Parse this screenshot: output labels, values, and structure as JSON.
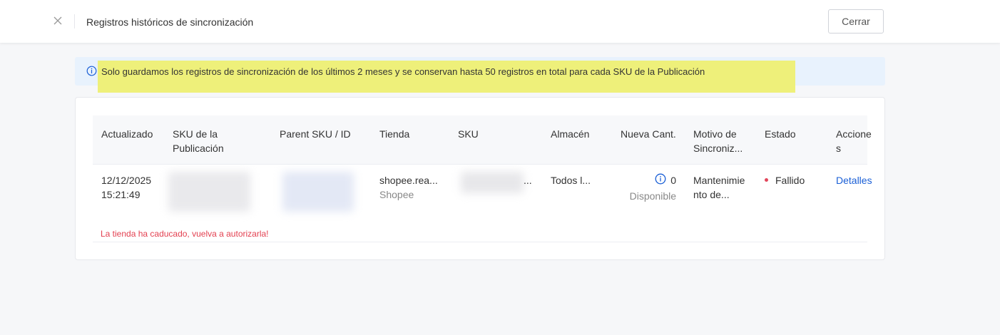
{
  "header": {
    "title": "Registros históricos de sincronización",
    "close_button": "Cerrar"
  },
  "notice": {
    "text": "Solo guardamos los registros de sincronización de los últimos 2 meses y se conservan hasta 50 registros en total para cada SKU de la Publicación",
    "highlight_color": "#eef07a"
  },
  "table": {
    "columns": [
      "Actualizado",
      "SKU de la Publicación",
      "Parent SKU / ID",
      "Tienda",
      "SKU",
      "Almacén",
      "Nueva Cant.",
      "Motivo de Sincroniz...",
      "Estado",
      "Acciones"
    ],
    "header_lines": {
      "sku_pub": [
        "SKU de la",
        "Publicación"
      ],
      "motivo": [
        "Motivo de",
        "Sincroniz..."
      ],
      "acciones": [
        "Accione",
        "s"
      ]
    },
    "rows": [
      {
        "date": "12/12/2025",
        "time": "15:21:49",
        "store_name": "shopee.rea...",
        "store_platform": "Shopee",
        "sku_suffix": "...",
        "warehouse": "Todos l...",
        "qty": "0",
        "qty_label": "Disponible",
        "reason_line1": "Mantenimie",
        "reason_line2": "nto de...",
        "status": "Fallido",
        "status_color": "#e2465b",
        "action": "Detalles"
      }
    ],
    "error_message": "La tienda ha caducado, vuelva a autorizarla!"
  },
  "icons": {
    "close": "close-icon",
    "info": "info-circle-icon"
  },
  "colors": {
    "accent": "#1a5fd6",
    "error": "#e34050",
    "notice_bg": "#e8f2fd"
  }
}
